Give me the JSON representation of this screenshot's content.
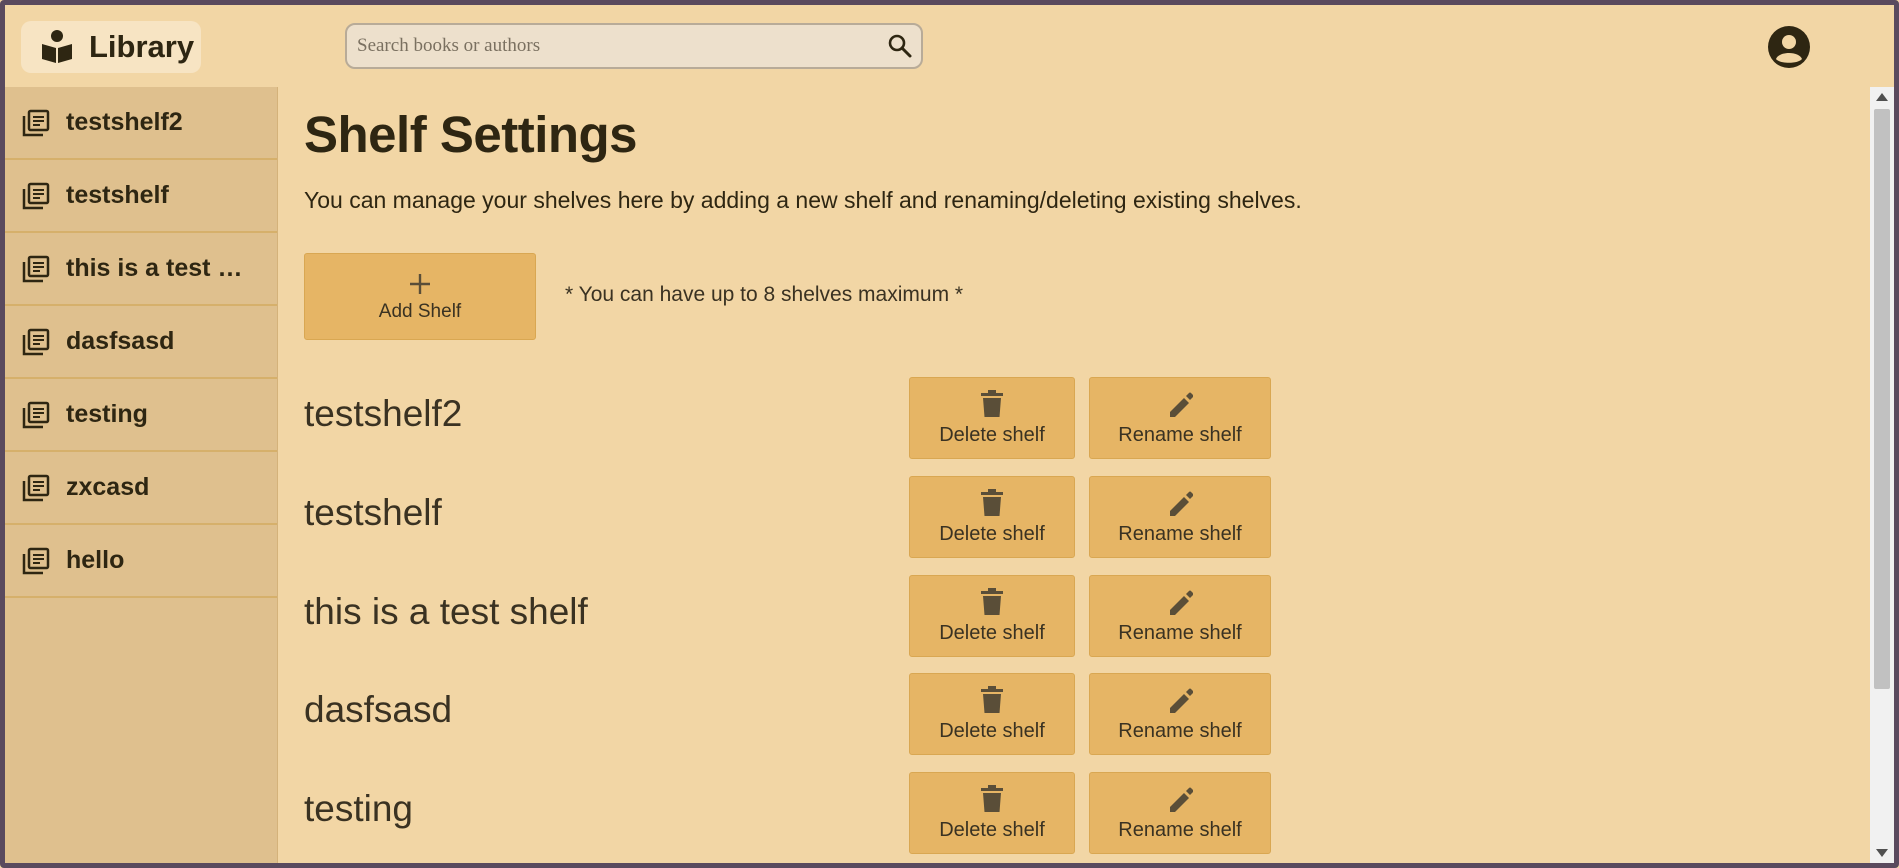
{
  "header": {
    "app_name": "Library",
    "search_placeholder": "Search books or authors"
  },
  "sidebar": {
    "items": [
      {
        "label": "testshelf2"
      },
      {
        "label": "testshelf"
      },
      {
        "label": "this is a test sh..."
      },
      {
        "label": "dasfsasd"
      },
      {
        "label": "testing"
      },
      {
        "label": "zxcasd"
      },
      {
        "label": "hello"
      }
    ]
  },
  "main": {
    "title": "Shelf Settings",
    "description": "You can manage your shelves here by adding a new shelf and renaming/deleting existing shelves.",
    "add_shelf_label": "Add Shelf",
    "limit_note": "* You can have up to 8 shelves maximum *",
    "delete_label": "Delete shelf",
    "rename_label": "Rename shelf",
    "shelves": [
      {
        "name": "testshelf2"
      },
      {
        "name": "testshelf"
      },
      {
        "name": "this is a test shelf"
      },
      {
        "name": "dasfsasd"
      },
      {
        "name": "testing"
      }
    ]
  },
  "icons": {
    "logo": "book-reader-icon",
    "search": "search-icon",
    "avatar": "user-circle-icon",
    "shelf": "library-books-icon",
    "add": "plus-icon",
    "delete": "trash-icon",
    "rename": "pencil-icon"
  },
  "colors": {
    "background": "#f2d6a5",
    "sidebar": "#dfc08e",
    "button": "#e6b565",
    "text": "#2e2612"
  }
}
